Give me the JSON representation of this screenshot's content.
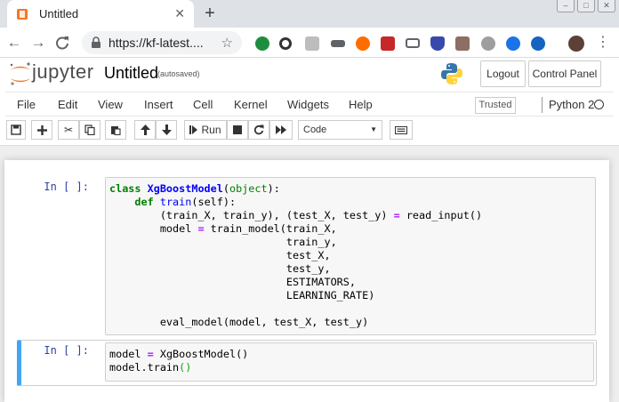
{
  "browser": {
    "tab_title": "Untitled",
    "tab_close": "✕",
    "new_tab": "+",
    "url": "https://kf-latest....",
    "colors": {
      "tab_favicon": "#f37726",
      "strip_bg": "#dee1e6"
    }
  },
  "jupyter": {
    "logo_text": "jupyter",
    "notebook_title": "Untitled",
    "autosave_status": "(autosaved)",
    "logout_label": "Logout",
    "control_panel_label": "Control Panel",
    "menu": [
      "File",
      "Edit",
      "View",
      "Insert",
      "Cell",
      "Kernel",
      "Widgets",
      "Help"
    ],
    "trusted_label": "Trusted",
    "kernel_name": "Python 2",
    "toolbar": {
      "run_label": "Run",
      "cell_type": "Code"
    }
  },
  "cells": [
    {
      "prompt": "In [ ]:",
      "lines": [
        "class XgBoostModel(object):",
        "    def train(self):",
        "        (train_X, train_y), (test_X, test_y) = read_input()",
        "        model = train_model(train_X,",
        "                            train_y,",
        "                            test_X,",
        "                            test_y,",
        "                            ESTIMATORS,",
        "                            LEARNING_RATE)",
        "",
        "        eval_model(model, test_X, test_y)"
      ]
    },
    {
      "prompt": "In [ ]:",
      "lines": [
        "model = XgBoostModel()",
        "model.train()"
      ]
    }
  ]
}
